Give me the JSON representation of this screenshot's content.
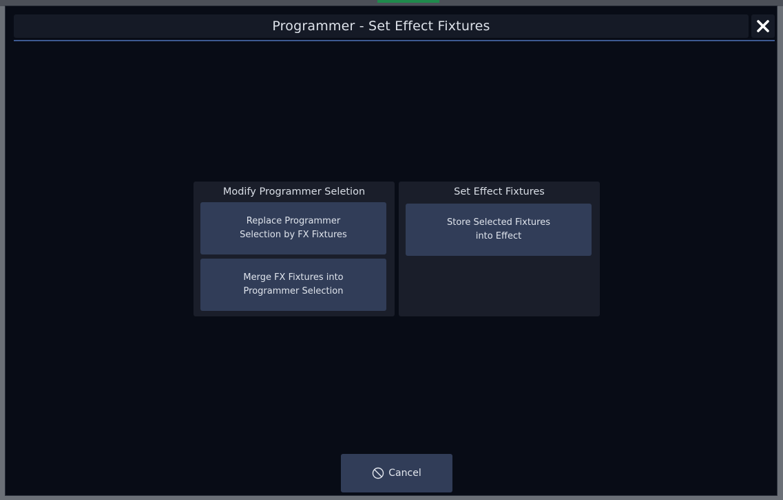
{
  "dialog": {
    "title": "Programmer - Set Effect Fixtures",
    "close_icon": "close-icon"
  },
  "sections": {
    "modify": {
      "heading": "Modify Programmer Seletion",
      "buttons": [
        {
          "line1": "Replace Programmer",
          "line2": "Selection by FX Fixtures"
        },
        {
          "line1": "Merge FX Fixtures into",
          "line2": "Programmer Selection"
        }
      ]
    },
    "set": {
      "heading": "Set Effect Fixtures",
      "buttons": [
        {
          "line1": "Store Selected Fixtures",
          "line2": "into Effect"
        }
      ]
    }
  },
  "footer": {
    "cancel_label": "Cancel",
    "cancel_icon": "prohibited-circle-icon"
  },
  "colors": {
    "window_bg": "#080c16",
    "title_bg": "#151a26",
    "accent_line": "#3d5a92",
    "panel_bg": "#1a1e2a",
    "button_bg": "#313d58",
    "text": "#dfe4ec"
  }
}
